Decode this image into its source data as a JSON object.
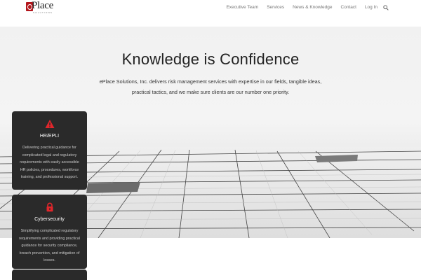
{
  "header": {
    "logo": {
      "text": "Place",
      "subtitle": "SOLUTIONS"
    },
    "nav": [
      {
        "label": "Executive Team"
      },
      {
        "label": "Services"
      },
      {
        "label": "News & Knowledge"
      },
      {
        "label": "Contact"
      },
      {
        "label": "Log In"
      }
    ],
    "search_icon": "search-icon"
  },
  "hero": {
    "title": "Knowledge is Confidence",
    "description": "ePlace Solutions, Inc. delivers risk management services with expertise in our fields, tangible ideas, practical tactics, and we make sure clients are our number one priority."
  },
  "cards": [
    {
      "icon": "warning-icon",
      "title": "HR/EPLI",
      "text": "Delivering practical guidance for complicated legal and regulatory requirements with easily accessible HR policies, procedures, workforce training, and professional support."
    },
    {
      "icon": "lock-icon",
      "title": "Cybersecurity",
      "text": "Simplifying complicated regulatory requirements and providing practical guidance for security compliance, breach prevention, and mitigation of losses."
    }
  ],
  "colors": {
    "accent": "#e0262b",
    "card_bg": "#2a2a2a",
    "text": "#222222"
  }
}
